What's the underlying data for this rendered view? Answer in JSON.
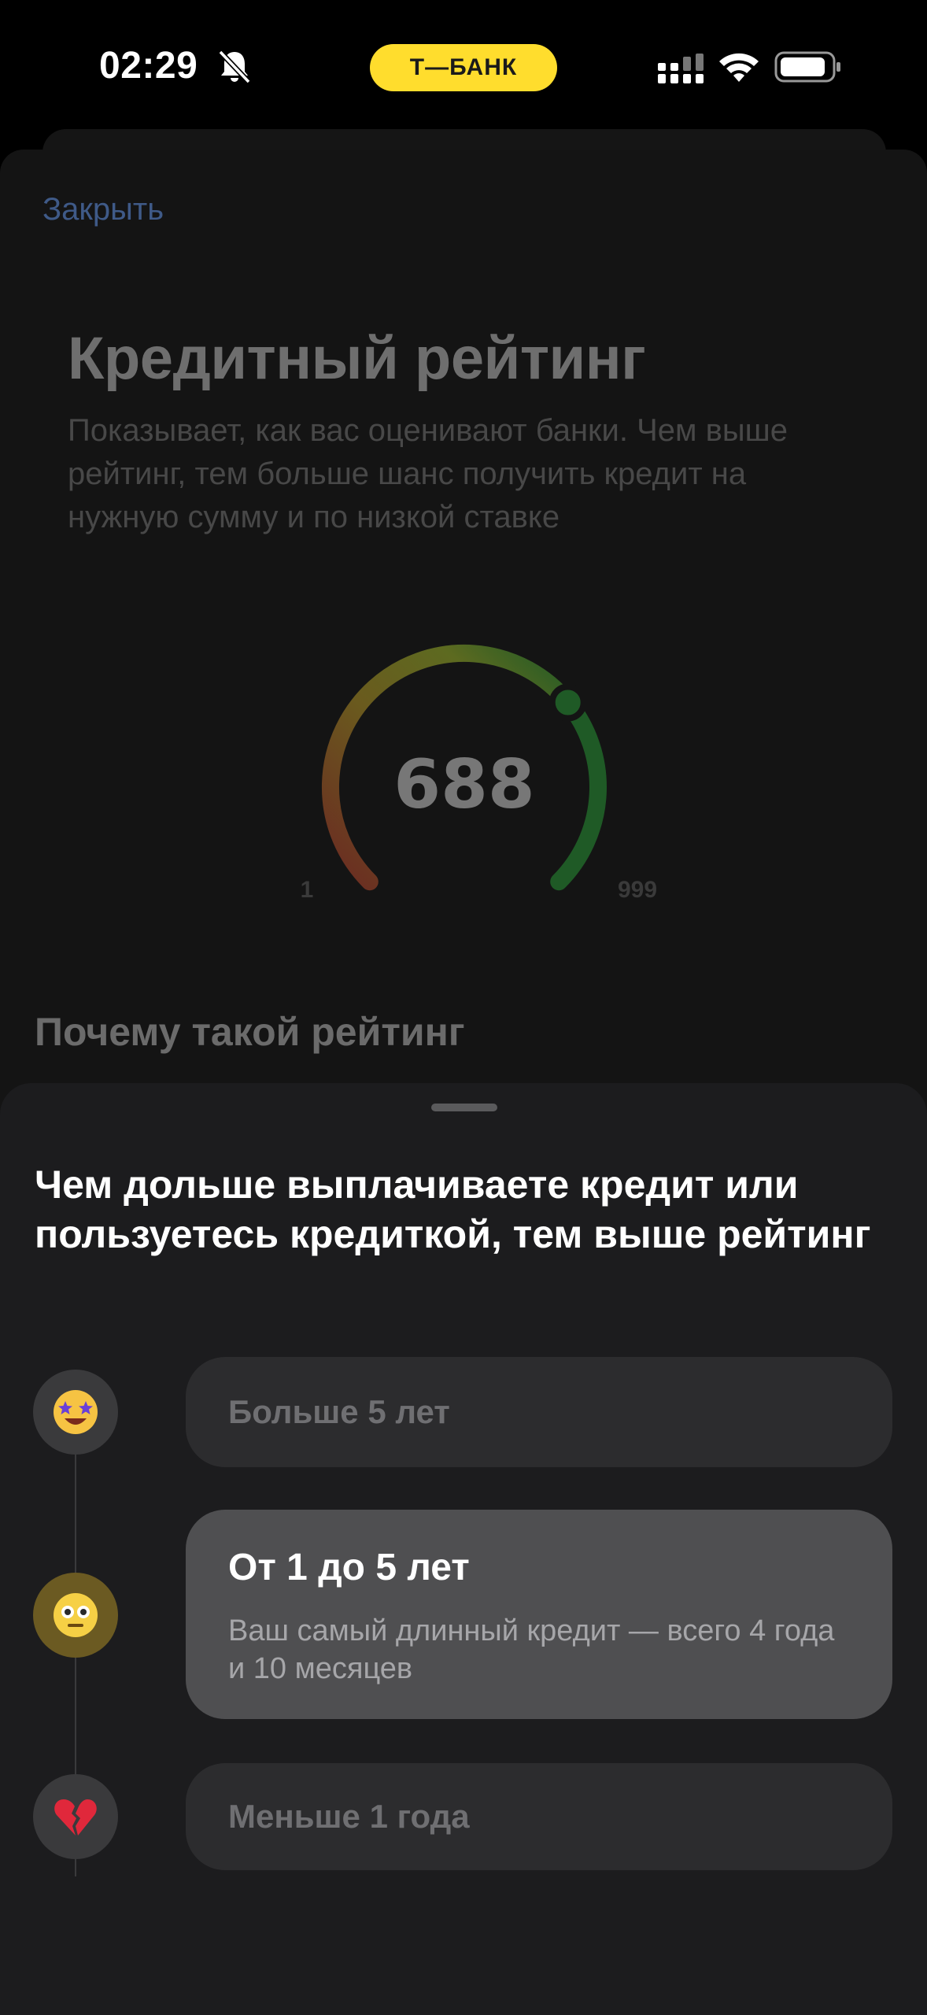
{
  "status_bar": {
    "time": "02:29",
    "bank_badge": "Т—БАНК",
    "accent_color": "#ffdd2d",
    "icons": [
      "bell-slash-icon",
      "cellular-signal-icon",
      "wifi-icon",
      "battery-icon"
    ]
  },
  "background": {
    "close_label": "Закрыть",
    "title": "Кредитный рейтинг",
    "description": "Показывает, как вас оценивают банки. Чем выше рейтинг, тем больше шанс получить кредит на нужную сумму и по низкой ставке",
    "gauge": {
      "value": "688",
      "min": "1",
      "max": "999",
      "fraction": 0.688
    },
    "section_title": "Почему такой рейтинг"
  },
  "sheet": {
    "title": "Чем дольше выплачиваете кредит или пользуетесь кредиткой, тем выше рейтинг",
    "options": [
      {
        "label": "Больше 5 лет",
        "emoji": "star-struck-emoji-icon",
        "active": false
      },
      {
        "label": "От 1 до 5 лет",
        "description": "Ваш самый длинный кредит — всего 4 года и 10 месяцев",
        "emoji": "neutral-face-emoji-icon",
        "active": true
      },
      {
        "label": "Меньше 1 года",
        "emoji": "broken-heart-emoji-icon",
        "active": false
      }
    ]
  }
}
